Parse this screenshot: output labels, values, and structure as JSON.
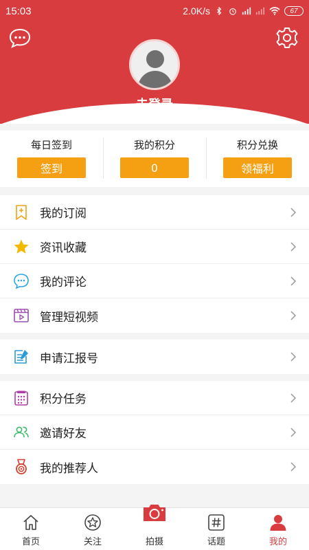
{
  "status_bar": {
    "time": "15:03",
    "network_speed": "2.0K/s",
    "battery": "67"
  },
  "header": {
    "login_label": "未登录",
    "icons": [
      "chat-bubble-icon",
      "gear-icon"
    ]
  },
  "stats": [
    {
      "label": "每日签到",
      "button": "签到"
    },
    {
      "label": "我的积分",
      "button": "0"
    },
    {
      "label": "积分兑换",
      "button": "领福利"
    }
  ],
  "menu": {
    "group1": [
      {
        "label": "我的订阅",
        "icon": "bookmark-add-icon"
      },
      {
        "label": "资讯收藏",
        "icon": "star-icon"
      },
      {
        "label": "我的评论",
        "icon": "comment-icon"
      },
      {
        "label": "管理短视频",
        "icon": "video-icon"
      }
    ],
    "group2": [
      {
        "label": "申请江报号",
        "icon": "edit-document-icon"
      }
    ],
    "group3": [
      {
        "label": "积分任务",
        "icon": "calendar-icon"
      },
      {
        "label": "邀请好友",
        "icon": "friends-icon"
      },
      {
        "label": "我的推荐人",
        "icon": "medal-icon"
      }
    ]
  },
  "tabbar": [
    {
      "label": "首页",
      "icon": "home-icon"
    },
    {
      "label": "关注",
      "icon": "star-circle-icon"
    },
    {
      "label": "拍摄",
      "icon": "camera-icon"
    },
    {
      "label": "话题",
      "icon": "hashtag-icon"
    },
    {
      "label": "我的",
      "icon": "user-icon",
      "active": true
    }
  ],
  "colors": {
    "brand_red": "#d93c3f",
    "button_orange": "#f4a012",
    "star_yellow": "#f5b800",
    "comment_blue": "#2aa7e0",
    "video_purple": "#9b4fb0",
    "doc_blue": "#2a9ad8",
    "task_purple": "#b23ba6",
    "friends_green": "#3dbb6b",
    "medal_red": "#d2402f"
  }
}
